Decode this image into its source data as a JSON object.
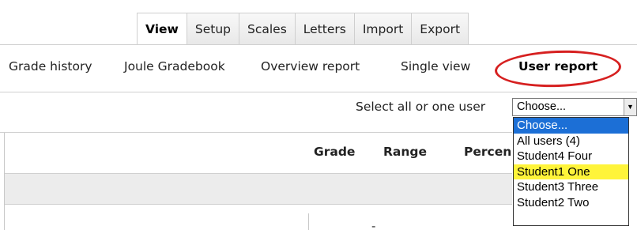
{
  "tabs": [
    {
      "label": "View",
      "active": true
    },
    {
      "label": "Setup",
      "active": false
    },
    {
      "label": "Scales",
      "active": false
    },
    {
      "label": "Letters",
      "active": false
    },
    {
      "label": "Import",
      "active": false
    },
    {
      "label": "Export",
      "active": false
    }
  ],
  "subnav": {
    "grade_history": "Grade history",
    "joule_gradebook": "Joule Gradebook",
    "overview_report": "Overview report",
    "single_view": "Single view",
    "user_report": "User report"
  },
  "user_select": {
    "label": "Select all or one user",
    "value": "Choose...",
    "options": [
      "Choose...",
      "All users (4)",
      "Student4 Four",
      "Student1 One",
      "Student3 Three",
      "Student2 Two"
    ],
    "selected_index": 0,
    "highlighted_index": 3
  },
  "table": {
    "headers": {
      "grade": "Grade",
      "range": "Range",
      "percentage": "Percen"
    },
    "cell_dash": "-"
  },
  "colors": {
    "annotation_ellipse": "#d62020",
    "option_selected": "#1c6fd6",
    "option_highlight": "#fff43a"
  }
}
